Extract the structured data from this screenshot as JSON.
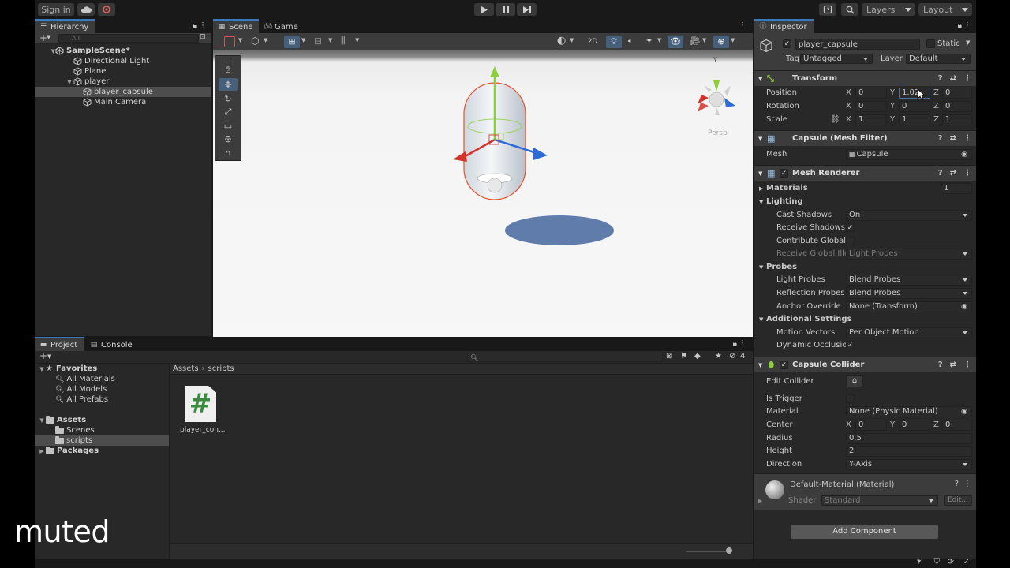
{
  "toolbar": {
    "sign_in": "Sign in",
    "layers": "Layers",
    "layout": "Layout"
  },
  "hierarchy": {
    "tab": "Hierarchy",
    "search_placeholder": "All",
    "items": [
      {
        "label": "SampleScene*",
        "depth": 0,
        "icon": "unity-scene-icon",
        "expanded": true
      },
      {
        "label": "Directional Light",
        "depth": 1,
        "icon": "gameobject-cube-icon"
      },
      {
        "label": "Plane",
        "depth": 1,
        "icon": "gameobject-cube-icon"
      },
      {
        "label": "player",
        "depth": 1,
        "icon": "gameobject-cube-icon",
        "expanded": true
      },
      {
        "label": "player_capsule",
        "depth": 2,
        "icon": "gameobject-cube-icon",
        "selected": true
      },
      {
        "label": "Main Camera",
        "depth": 1,
        "icon": "gameobject-cube-icon"
      }
    ]
  },
  "scene": {
    "tabs": [
      "Scene",
      "Game"
    ],
    "btn_2d": "2D",
    "persp_label": "Persp",
    "gizmo_y_label": "y"
  },
  "inspector": {
    "tab": "Inspector",
    "object_name": "player_capsule",
    "static_label": "Static",
    "tag_label": "Tag",
    "tag_value": "Untagged",
    "layer_label": "Layer",
    "layer_value": "Default",
    "transform": {
      "title": "Transform",
      "position_label": "Position",
      "rotation_label": "Rotation",
      "scale_label": "Scale",
      "position": {
        "x": "0",
        "y": "1.02",
        "z": "0"
      },
      "rotation": {
        "x": "0",
        "y": "0",
        "z": "0"
      },
      "scale": {
        "x": "1",
        "y": "1",
        "z": "1"
      }
    },
    "mesh_filter": {
      "title": "Capsule (Mesh Filter)",
      "mesh_label": "Mesh",
      "mesh_value": "Capsule"
    },
    "mesh_renderer": {
      "title": "Mesh Renderer",
      "materials_label": "Materials",
      "materials_count": "1",
      "lighting_label": "Lighting",
      "cast_shadows_label": "Cast Shadows",
      "cast_shadows_value": "On",
      "receive_shadows_label": "Receive Shadows",
      "contribute_gi_label": "Contribute Global I",
      "receive_gi_label": "Receive Global Illu",
      "receive_gi_value": "Light Probes",
      "probes_label": "Probes",
      "light_probes_label": "Light Probes",
      "light_probes_value": "Blend Probes",
      "reflection_probes_label": "Reflection Probes",
      "reflection_probes_value": "Blend Probes",
      "anchor_override_label": "Anchor Override",
      "anchor_override_value": "None (Transform)",
      "additional_settings_label": "Additional Settings",
      "motion_vectors_label": "Motion Vectors",
      "motion_vectors_value": "Per Object Motion",
      "dynamic_occlusion_label": "Dynamic Occlusion"
    },
    "capsule_collider": {
      "title": "Capsule Collider",
      "edit_collider_label": "Edit Collider",
      "is_trigger_label": "Is Trigger",
      "material_label": "Material",
      "material_value": "None (Physic Material)",
      "center_label": "Center",
      "center": {
        "x": "0",
        "y": "0",
        "z": "0"
      },
      "radius_label": "Radius",
      "radius_value": "0.5",
      "height_label": "Height",
      "height_value": "2",
      "direction_label": "Direction",
      "direction_value": "Y-Axis"
    },
    "material": {
      "title": "Default-Material (Material)",
      "shader_label": "Shader",
      "shader_value": "Standard",
      "edit_button": "Edit..."
    },
    "add_component": "Add Component",
    "axis_labels": {
      "x": "X",
      "y": "Y",
      "z": "Z"
    }
  },
  "project": {
    "tabs": [
      "Project",
      "Console"
    ],
    "favorites_label": "Favorites",
    "favorites": [
      "All Materials",
      "All Models",
      "All Prefabs"
    ],
    "assets_label": "Assets",
    "asset_folders": [
      "Scenes",
      "scripts"
    ],
    "packages_label": "Packages",
    "breadcrumb": [
      "Assets",
      "scripts"
    ],
    "hidden_count": "4",
    "files": [
      {
        "name": "player_con...",
        "icon": "csharp-script-icon"
      }
    ]
  },
  "overlay_text": "muted",
  "colors": {
    "accent": "#3a79bb",
    "selection": "#4d4d4d",
    "axis_x": "#d2332b",
    "axis_y": "#8ccf3a",
    "axis_z": "#2f6bd6",
    "script_icon": "#3c8a3e"
  }
}
